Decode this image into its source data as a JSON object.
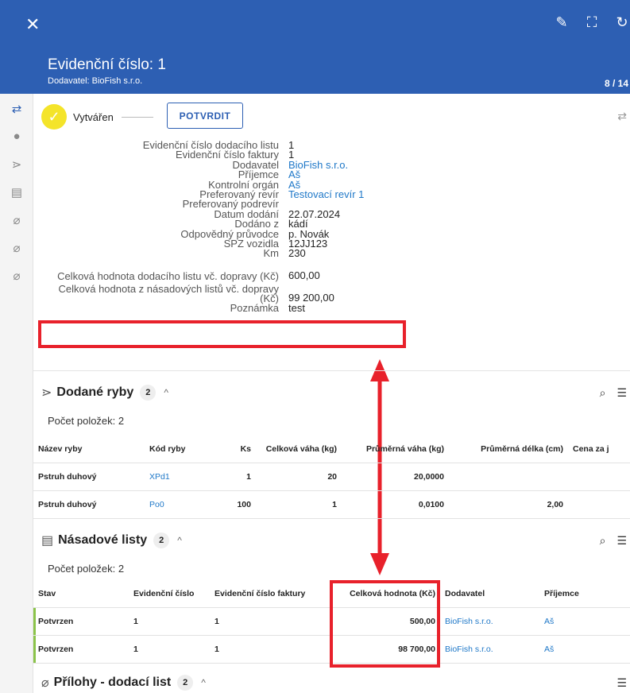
{
  "header": {
    "close_icon": "close-icon",
    "title": "Evidenční číslo: 1",
    "subtitle": "Dodavatel: BioFish s.r.o.",
    "pager": "8 / 14",
    "icons": [
      "edit-icon",
      "fullscreen-icon",
      "refresh-icon"
    ]
  },
  "rail": {
    "items": [
      "workflow-icon",
      "info-icon",
      "fish-icon",
      "document-fish-icon",
      "attachment-icon",
      "attachment-icon",
      "attachment-icon"
    ]
  },
  "status": {
    "label": "Vytvářen",
    "confirm_button": "POTVRDIT",
    "state_color": "#f4e42a"
  },
  "details": [
    {
      "label": "Evidenční číslo dodacího listu",
      "value": "1",
      "link": false
    },
    {
      "label": "Evidenční číslo faktury",
      "value": "1",
      "link": false
    },
    {
      "label": "Dodavatel",
      "value": "BioFish s.r.o.",
      "link": true
    },
    {
      "label": "Příjemce",
      "value": "Aš",
      "link": true
    },
    {
      "label": "Kontrolní orgán",
      "value": "Aš",
      "link": true
    },
    {
      "label": "Preferovaný revír",
      "value": "Testovací revír 1",
      "link": true
    },
    {
      "label": "Preferovaný podrevír",
      "value": "",
      "link": false
    },
    {
      "label": "Datum dodání",
      "value": "22.07.2024",
      "link": false
    },
    {
      "label": "Dodáno z",
      "value": "kádí",
      "link": false
    },
    {
      "label": "Odpovědný průvodce",
      "value": "p. Novák",
      "link": false
    },
    {
      "label": "SPZ vozidla",
      "value": "12JJ123",
      "link": false
    },
    {
      "label": "Km",
      "value": "230",
      "link": false
    },
    {
      "label": "Celková hodnota dodacího listu vč. dopravy (Kč)",
      "value": "600,00",
      "link": false
    },
    {
      "label": "Celková hodnota z násadových listů vč. dopravy (Kč)",
      "value": "99 200,00",
      "link": false
    },
    {
      "label": "Poznámka",
      "value": "test",
      "link": false
    }
  ],
  "fish_section": {
    "title": "Dodané ryby",
    "badge": "2",
    "count": "Počet položek: 2",
    "columns": [
      "Název ryby",
      "Kód ryby",
      "Ks",
      "Celková váha (kg)",
      "Průměrná váha (kg)",
      "Průměrná délka (cm)",
      "Cena za j"
    ],
    "rows": [
      [
        "Pstruh duhový",
        "XPd1",
        "1",
        "20",
        "20,0000",
        "",
        ""
      ],
      [
        "Pstruh duhový",
        "Po0",
        "100",
        "1",
        "0,0100",
        "2,00",
        ""
      ]
    ]
  },
  "stocking_section": {
    "title": "Násadové listy",
    "badge": "2",
    "count": "Počet položek: 2",
    "columns": [
      "Stav",
      "Evidenční číslo",
      "Evidenční číslo faktury",
      "Celková hodnota (Kč)",
      "Dodavatel",
      "Příjemce"
    ],
    "rows": [
      [
        "Potvrzen",
        "1",
        "1",
        "500,00",
        "BioFish s.r.o.",
        "Aš"
      ],
      [
        "Potvrzen",
        "1",
        "1",
        "98 700,00",
        "BioFish s.r.o.",
        "Aš"
      ]
    ]
  },
  "attachments_section": {
    "title": "Přílohy - dodací list",
    "badge": "2"
  },
  "colors": {
    "header": "#2d5fb3",
    "highlight": "#e8212b",
    "link": "#1f78c8",
    "confirmed": "#8bc34a"
  }
}
